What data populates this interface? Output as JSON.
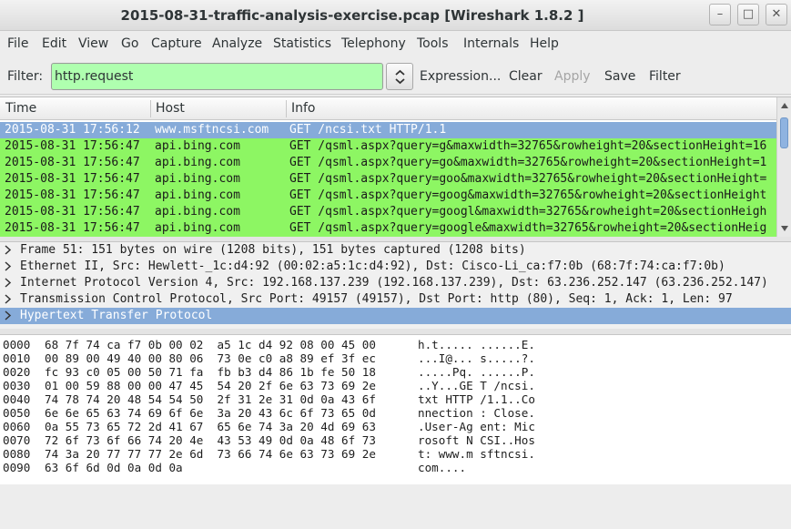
{
  "window": {
    "title": "2015-08-31-traffic-analysis-exercise.pcap   [Wireshark 1.8.2 ]",
    "minimize": "–",
    "maximize": "□",
    "close": "✕"
  },
  "menu": [
    "File",
    "Edit",
    "View",
    "Go",
    "Capture",
    "Analyze",
    "Statistics",
    "Telephony",
    "Tools",
    "Internals",
    "Help"
  ],
  "filter": {
    "label": "Filter:",
    "value": "http.request",
    "input_color": "#afffaf",
    "buttons": {
      "expression": "Expression...",
      "clear": "Clear",
      "apply": "Apply",
      "save": "Save",
      "filter": "Filter"
    }
  },
  "packet_list": {
    "columns": [
      "Time",
      "Host",
      "Info"
    ],
    "rows": [
      {
        "time": "2015-08-31 17:56:12",
        "host": "www.msftncsi.com",
        "info": "GET /ncsi.txt HTTP/1.1",
        "selected": true
      },
      {
        "time": "2015-08-31 17:56:47",
        "host": "api.bing.com",
        "info": "GET /qsml.aspx?query=g&maxwidth=32765&rowheight=20&sectionHeight=16",
        "selected": false
      },
      {
        "time": "2015-08-31 17:56:47",
        "host": "api.bing.com",
        "info": "GET /qsml.aspx?query=go&maxwidth=32765&rowheight=20&sectionHeight=1",
        "selected": false
      },
      {
        "time": "2015-08-31 17:56:47",
        "host": "api.bing.com",
        "info": "GET /qsml.aspx?query=goo&maxwidth=32765&rowheight=20&sectionHeight=",
        "selected": false
      },
      {
        "time": "2015-08-31 17:56:47",
        "host": "api.bing.com",
        "info": "GET /qsml.aspx?query=goog&maxwidth=32765&rowheight=20&sectionHeight",
        "selected": false
      },
      {
        "time": "2015-08-31 17:56:47",
        "host": "api.bing.com",
        "info": "GET /qsml.aspx?query=googl&maxwidth=32765&rowheight=20&sectionHeigh",
        "selected": false
      },
      {
        "time": "2015-08-31 17:56:47",
        "host": "api.bing.com",
        "info": "GET /qsml.aspx?query=google&maxwidth=32765&rowheight=20&sectionHeig",
        "selected": false
      }
    ],
    "colors": {
      "selected": "#86abd9",
      "http": "#8df663"
    }
  },
  "details": [
    {
      "text": "Frame 51: 151 bytes on wire (1208 bits), 151 bytes captured (1208 bits)",
      "selected": false
    },
    {
      "text": "Ethernet II, Src: Hewlett-_1c:d4:92 (00:02:a5:1c:d4:92), Dst: Cisco-Li_ca:f7:0b (68:7f:74:ca:f7:0b)",
      "selected": false
    },
    {
      "text": "Internet Protocol Version 4, Src: 192.168.137.239 (192.168.137.239), Dst: 63.236.252.147 (63.236.252.147)",
      "selected": false
    },
    {
      "text": "Transmission Control Protocol, Src Port: 49157 (49157), Dst Port: http (80), Seq: 1, Ack: 1, Len: 97",
      "selected": false
    },
    {
      "text": "Hypertext Transfer Protocol",
      "selected": true
    }
  ],
  "bytes": [
    {
      "offset": "0000",
      "hex": "68 7f 74 ca f7 0b 00 02  a5 1c d4 92 08 00 45 00",
      "ascii": "h.t..... ......E."
    },
    {
      "offset": "0010",
      "hex": "00 89 00 49 40 00 80 06  73 0e c0 a8 89 ef 3f ec",
      "ascii": "...I@... s.....?."
    },
    {
      "offset": "0020",
      "hex": "fc 93 c0 05 00 50 71 fa  fb b3 d4 86 1b fe 50 18",
      "ascii": ".....Pq. ......P."
    },
    {
      "offset": "0030",
      "hex": "01 00 59 88 00 00 47 45  54 20 2f 6e 63 73 69 2e",
      "ascii": "..Y...GE T /ncsi."
    },
    {
      "offset": "0040",
      "hex": "74 78 74 20 48 54 54 50  2f 31 2e 31 0d 0a 43 6f",
      "ascii": "txt HTTP /1.1..Co"
    },
    {
      "offset": "0050",
      "hex": "6e 6e 65 63 74 69 6f 6e  3a 20 43 6c 6f 73 65 0d",
      "ascii": "nnection : Close."
    },
    {
      "offset": "0060",
      "hex": "0a 55 73 65 72 2d 41 67  65 6e 74 3a 20 4d 69 63",
      "ascii": ".User-Ag ent: Mic"
    },
    {
      "offset": "0070",
      "hex": "72 6f 73 6f 66 74 20 4e  43 53 49 0d 0a 48 6f 73",
      "ascii": "rosoft N CSI..Hos"
    },
    {
      "offset": "0080",
      "hex": "74 3a 20 77 77 77 2e 6d  73 66 74 6e 63 73 69 2e",
      "ascii": "t: www.m sftncsi."
    },
    {
      "offset": "0090",
      "hex": "63 6f 6d 0d 0a 0d 0a",
      "ascii": "com...."
    }
  ]
}
